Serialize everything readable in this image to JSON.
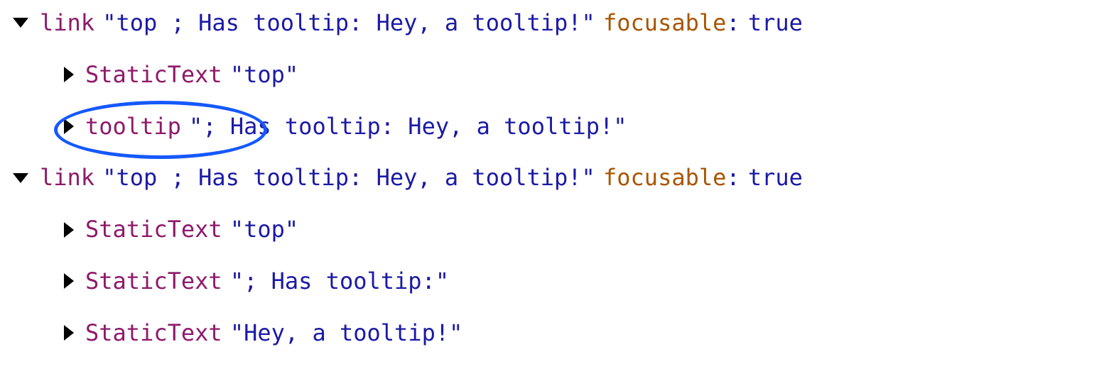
{
  "colors": {
    "role": "#8e1a6a",
    "string": "#1b1aa5",
    "property": "#aa5500",
    "annotation": "#1558ff"
  },
  "rows": [
    {
      "id": "r1",
      "indent": 0,
      "expanded": true,
      "role": "link",
      "string": "\"top ; Has tooltip: Hey, a tooltip!\"",
      "prop_name": "focusable",
      "prop_value": "true"
    },
    {
      "id": "r2",
      "indent": 1,
      "expanded": false,
      "role": "StaticText",
      "string": "\"top\""
    },
    {
      "id": "r3",
      "indent": 1,
      "expanded": false,
      "role": "tooltip",
      "string": "\"; Has tooltip: Hey, a tooltip!\""
    },
    {
      "id": "r4",
      "indent": 0,
      "expanded": true,
      "role": "link",
      "string": "\"top ; Has tooltip: Hey, a tooltip!\"",
      "prop_name": "focusable",
      "prop_value": "true"
    },
    {
      "id": "r5",
      "indent": 1,
      "expanded": false,
      "role": "StaticText",
      "string": "\"top\""
    },
    {
      "id": "r6",
      "indent": 1,
      "expanded": false,
      "role": "StaticText",
      "string": "\"; Has tooltip:\""
    },
    {
      "id": "r7",
      "indent": 1,
      "expanded": false,
      "role": "StaticText",
      "string": "\"Hey, a tooltip!\""
    }
  ],
  "annotation": {
    "target_row": "r3",
    "shape": "ellipse"
  }
}
